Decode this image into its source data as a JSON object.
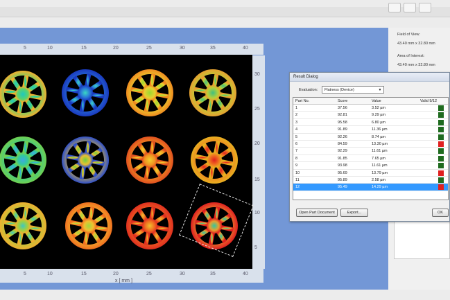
{
  "right_panel": {
    "field_of_view_label": "Field of View:",
    "field_of_view_value": "43.40 mm x 32.80 mm",
    "area_of_interest_label": "Area of Interest:",
    "area_of_interest_value": "43.40 mm x 32.80 mm"
  },
  "plot": {
    "x_axis_label": "x [ mm ]",
    "x_ticks_top": [
      "5",
      "10",
      "15",
      "20",
      "25",
      "30",
      "35",
      "40"
    ],
    "x_ticks_bottom": [
      "5",
      "10",
      "15",
      "20",
      "25",
      "30",
      "35",
      "40"
    ],
    "y_ticks_right": [
      "30",
      "25",
      "20",
      "15",
      "10",
      "5"
    ]
  },
  "dialog": {
    "title": "Result Dialog",
    "evaluation_label": "Evaluation:",
    "evaluation_value": "Flatness (Device)",
    "columns": [
      "Part No.",
      "Score",
      "Value",
      "Valid 9/12"
    ],
    "rows": [
      {
        "part": "1",
        "score": "37.56",
        "value": "3.52 µm",
        "valid": true
      },
      {
        "part": "2",
        "score": "92.81",
        "value": "9.29 µm",
        "valid": true
      },
      {
        "part": "3",
        "score": "95.58",
        "value": "6.80 µm",
        "valid": true
      },
      {
        "part": "4",
        "score": "91.89",
        "value": "11.36 µm",
        "valid": true
      },
      {
        "part": "5",
        "score": "92.26",
        "value": "8.74 µm",
        "valid": true
      },
      {
        "part": "6",
        "score": "84.59",
        "value": "13.30 µm",
        "valid": false
      },
      {
        "part": "7",
        "score": "92.29",
        "value": "11.61 µm",
        "valid": true
      },
      {
        "part": "8",
        "score": "91.85",
        "value": "7.65 µm",
        "valid": true
      },
      {
        "part": "9",
        "score": "93.98",
        "value": "11.61 µm",
        "valid": true
      },
      {
        "part": "10",
        "score": "95.69",
        "value": "13.79 µm",
        "valid": false
      },
      {
        "part": "11",
        "score": "95.89",
        "value": "2.58 µm",
        "valid": true
      },
      {
        "part": "12",
        "score": "95.49",
        "value": "14.29 µm",
        "valid": false
      }
    ],
    "selected_row": "12",
    "open_part_button": "Open Part Document",
    "export_button": "Export...",
    "ok_button": "OK"
  },
  "colors": {
    "valid": "#1f6b1f",
    "invalid": "#e02020",
    "selection": "#3399ff",
    "viewport": "#7397d6"
  }
}
